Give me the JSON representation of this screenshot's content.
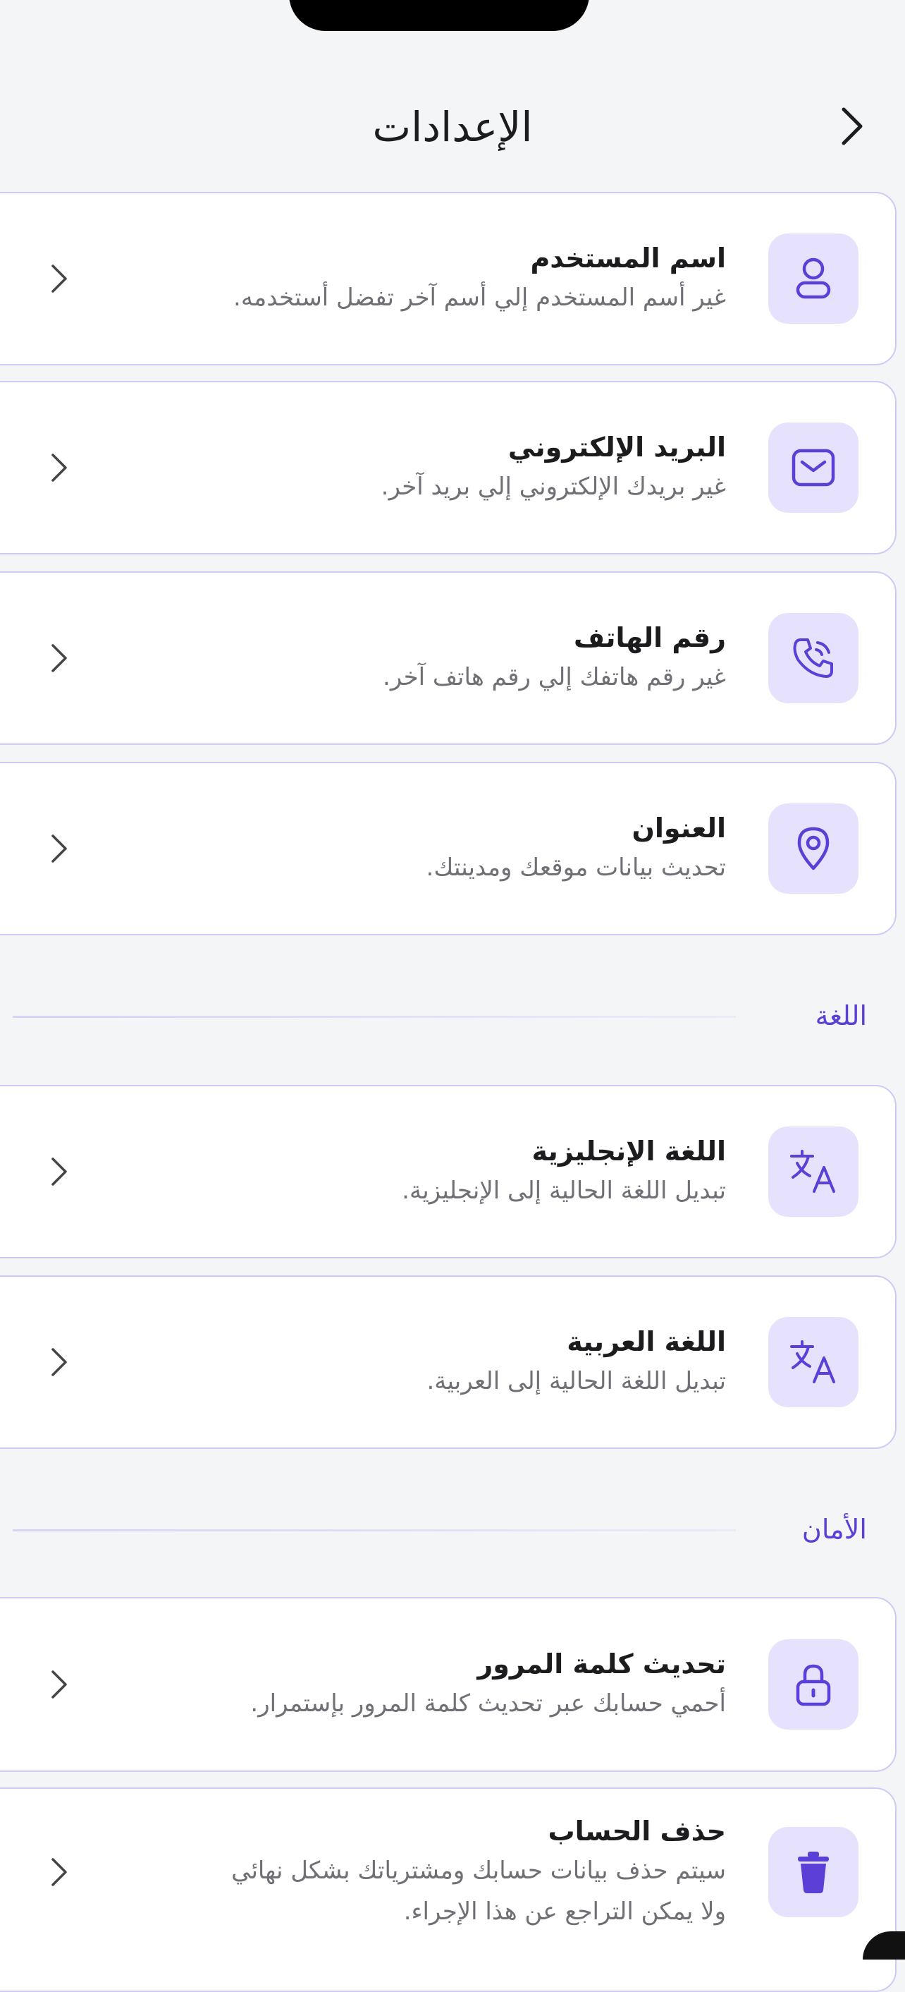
{
  "header": {
    "title": "الإعدادات"
  },
  "account": {
    "items": [
      {
        "icon": "user-icon",
        "title": "اسم المستخدم",
        "subtitle": "غير أسم المستخدم إلي أسم آخر تفضل أستخدمه."
      },
      {
        "icon": "mail-icon",
        "title": "البريد الإلكتروني",
        "subtitle": "غير بريدك الإلكتروني إلي بريد آخر."
      },
      {
        "icon": "phone-icon",
        "title": "رقم الهاتف",
        "subtitle": "غير رقم هاتفك إلي رقم هاتف آخر."
      },
      {
        "icon": "location-pin-icon",
        "title": "العنوان",
        "subtitle": "تحديث بيانات موقعك ومدينتك."
      }
    ]
  },
  "language": {
    "label": "اللغة",
    "items": [
      {
        "icon": "translate-icon",
        "title": "اللغة الإنجليزية",
        "subtitle": "تبديل اللغة الحالية إلى الإنجليزية."
      },
      {
        "icon": "translate-icon",
        "title": "اللغة العربية",
        "subtitle": "تبديل اللغة الحالية إلى العربية."
      }
    ]
  },
  "security": {
    "label": "الأمان",
    "items": [
      {
        "icon": "lock-icon",
        "title": "تحديث كلمة المرور",
        "subtitle": "أحمي حسابك عبر تحديث كلمة المرور بإستمرار."
      },
      {
        "icon": "trash-icon",
        "title": "حذف الحساب",
        "subtitle": "سيتم حذف بيانات حسابك ومشترياتك بشكل نهائي",
        "subtitle2": "ولا يمكن التراجع عن هذا الإجراء."
      }
    ]
  },
  "colors": {
    "accent": "#5b3fd6",
    "icon_bg": "#e6e2fd",
    "card_border": "#cfcaf5"
  }
}
